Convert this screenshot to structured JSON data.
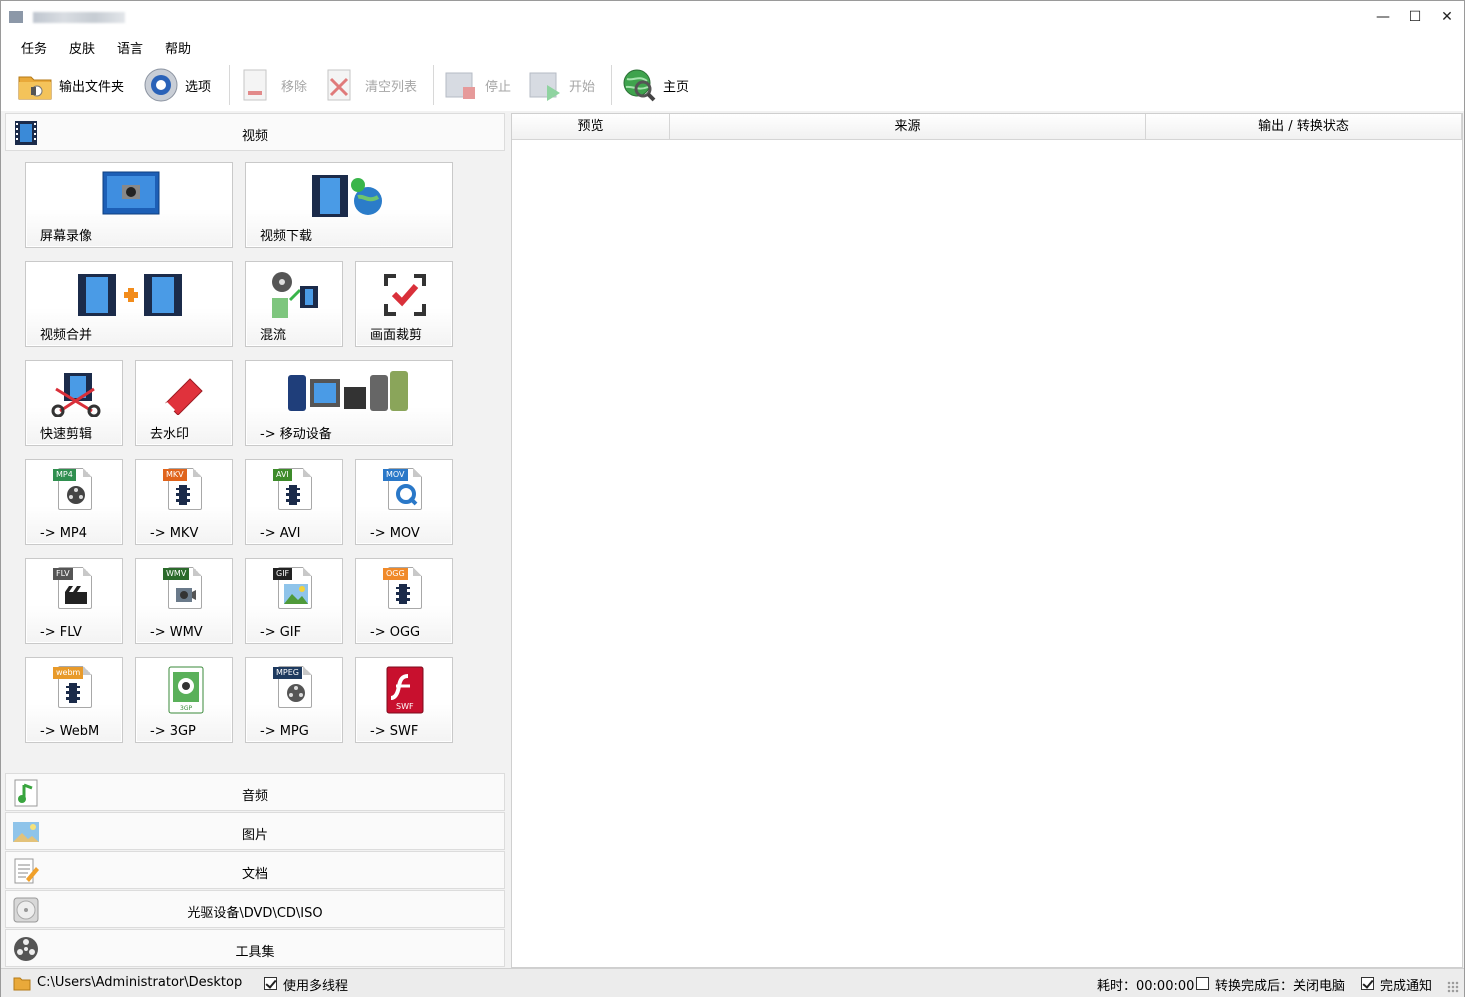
{
  "window": {
    "title_blurred": true,
    "minimize": "—",
    "maximize": "☐",
    "close": "✕"
  },
  "menu": [
    "任务",
    "皮肤",
    "语言",
    "帮助"
  ],
  "toolbar": {
    "output_folder": "输出文件夹",
    "options": "选项",
    "remove": "移除",
    "clear_list": "清空列表",
    "stop": "停止",
    "start": "开始",
    "home": "主页"
  },
  "categories": {
    "video": "视频",
    "audio": "音频",
    "image": "图片",
    "document": "文档",
    "disc": "光驱设备\\DVD\\CD\\ISO",
    "tools": "工具集"
  },
  "video_tiles": {
    "screen_record": "屏幕录像",
    "video_download": "视频下载",
    "video_merge": "视频合并",
    "mux": "混流",
    "crop": "画面裁剪",
    "quick_cut": "快速剪辑",
    "remove_watermark": "去水印",
    "mobile": "-> 移动设备",
    "mp4": "-> MP4",
    "mkv": "-> MKV",
    "avi": "-> AVI",
    "mov": "-> MOV",
    "flv": "-> FLV",
    "wmv": "-> WMV",
    "gif": "-> GIF",
    "ogg": "-> OGG",
    "webm": "-> WebM",
    "3gp": "-> 3GP",
    "mpg": "-> MPG",
    "swf": "-> SWF"
  },
  "format_tags": {
    "mp4": "MP4",
    "mkv": "MKV",
    "avi": "AVI",
    "mov": "MOV",
    "flv": "FLV",
    "wmv": "WMV",
    "gif": "GIF",
    "ogg": "OGG",
    "webm": "webm",
    "3gp": "3GP",
    "mpg": "MPEG",
    "swf": "SWF"
  },
  "table": {
    "columns": [
      "预览",
      "来源",
      "输出 / 转换状态"
    ]
  },
  "status": {
    "path": "C:\\Users\\Administrator\\Desktop",
    "multithread": "使用多线程",
    "multithread_checked": true,
    "elapsed_label": "耗时：00:00:00",
    "after_convert": "转换完成后：关闭电脑",
    "after_convert_checked": false,
    "notify": "完成通知",
    "notify_checked": true
  },
  "colors": {
    "accent_red": "#d9303a",
    "film_blue": "#1b2b4a",
    "swf_red": "#c8102e"
  }
}
